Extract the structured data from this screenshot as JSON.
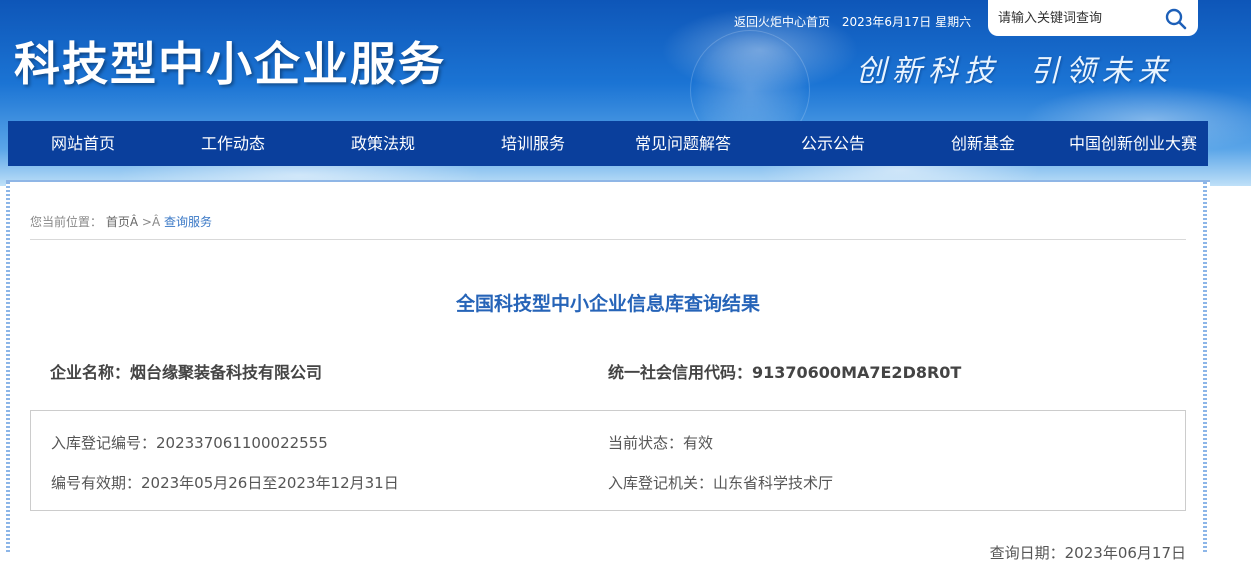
{
  "header": {
    "site_title": "科技型中小企业服务",
    "slogan": "创新科技 引领未来",
    "back_link": "返回火炬中心首页",
    "date_text": "2023年6月17日 星期六",
    "search_placeholder": "请输入关键词查询"
  },
  "nav": {
    "items": [
      {
        "label": "网站首页"
      },
      {
        "label": "工作动态"
      },
      {
        "label": "政策法规"
      },
      {
        "label": "培训服务"
      },
      {
        "label": "常见问题解答"
      },
      {
        "label": "公示公告"
      },
      {
        "label": "创新基金"
      },
      {
        "label": "中国创新创业大赛"
      }
    ]
  },
  "breadcrumb": {
    "prefix": "您当前位置：",
    "home": "首页Â",
    "separator": ">Â",
    "current": "查询服务"
  },
  "result": {
    "title": "全国科技型中小企业信息库查询结果",
    "company_name": "企业名称：烟台缘聚装备科技有限公司",
    "credit_code": "统一社会信用代码：91370600MA7E2D8R0T",
    "registration_no": "入库登记编号：202337061100022555",
    "status": "当前状态：有效",
    "validity": "编号有效期：2023年05月26日至2023年12月31日",
    "authority": "入库登记机关：山东省科学技术厅",
    "query_date": "查询日期：2023年06月17日"
  },
  "colors": {
    "nav_bg": "#0a3f9c",
    "title_blue": "#2664b8",
    "breadcrumb_current": "#3a78c6"
  }
}
